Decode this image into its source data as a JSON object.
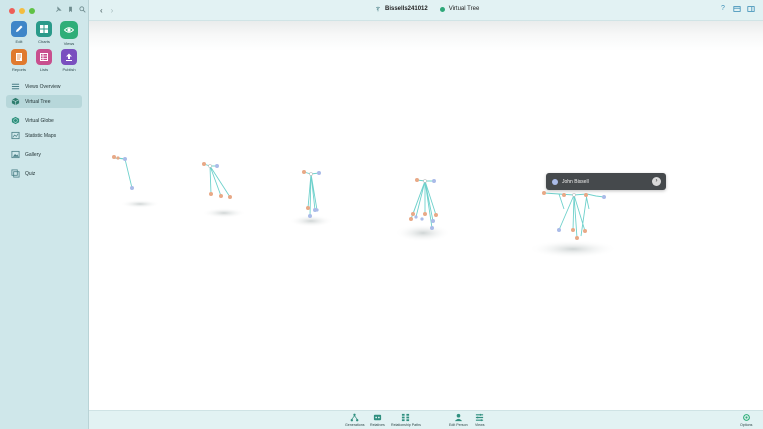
{
  "colors": {
    "sidebar_bg": "#cfe7ea",
    "edit": "#3f86c8",
    "charts": "#2a9a8a",
    "views": "#2fae78",
    "reports": "#e07a2e",
    "lists": "#c84f8e",
    "publish": "#7a4fbf",
    "accent": "#2ea879",
    "link_line": "#6fd1cc"
  },
  "sidebar": {
    "modes": [
      {
        "label": "Edit",
        "icon": "pencil-icon"
      },
      {
        "label": "Charts",
        "icon": "charts-icon"
      },
      {
        "label": "Views",
        "icon": "eye-icon"
      },
      {
        "label": "Reports",
        "icon": "reports-icon"
      },
      {
        "label": "Lists",
        "icon": "lists-icon"
      },
      {
        "label": "Publish",
        "icon": "upload-icon"
      }
    ],
    "items": [
      {
        "label": "Views Overview",
        "icon": "list-icon"
      },
      {
        "label": "Virtual Tree",
        "icon": "cube-icon"
      },
      {
        "label": "Virtual Globe",
        "icon": "globe-icon"
      },
      {
        "label": "Statistic Maps",
        "icon": "map-icon"
      },
      {
        "label": "Gallery",
        "icon": "gallery-icon"
      },
      {
        "label": "Quiz",
        "icon": "quiz-icon"
      }
    ]
  },
  "titlebar": {
    "database": "Bissells241012",
    "view": "Virtual Tree"
  },
  "tooltip": {
    "name": "John Bissell"
  },
  "toolbar": {
    "items": [
      {
        "label": "Generations",
        "icon": "generations-icon"
      },
      {
        "label": "Relatives",
        "icon": "relatives-icon"
      },
      {
        "label": "Relationship Paths",
        "icon": "relationship-paths-icon"
      },
      {
        "label": "Edit Person",
        "icon": "edit-person-icon"
      },
      {
        "label": "Views",
        "icon": "views-icon"
      },
      {
        "label": "Options",
        "icon": "options-icon"
      }
    ]
  }
}
